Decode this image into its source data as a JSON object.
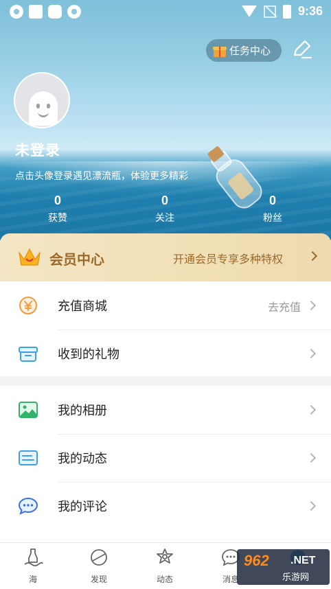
{
  "status_bar": {
    "time": "9:36"
  },
  "header": {
    "task_center_label": "任务中心",
    "username": "未登录",
    "login_hint": "点击头像登录遇见漂流瓶，体验更多精彩"
  },
  "stats": [
    {
      "value": "0",
      "label": "获赞"
    },
    {
      "value": "0",
      "label": "关注"
    },
    {
      "value": "0",
      "label": "粉丝"
    }
  ],
  "vip": {
    "title": "会员中心",
    "description": "开通会员专享多种特权"
  },
  "menu_group_1": [
    {
      "label": "充值商城",
      "right_text": "去充值",
      "icon": "coin-yen-icon"
    },
    {
      "label": "收到的礼物",
      "right_text": "",
      "icon": "gift-box-icon"
    }
  ],
  "menu_group_2": [
    {
      "label": "我的相册",
      "icon": "photo-album-icon"
    },
    {
      "label": "我的动态",
      "icon": "feed-card-icon"
    },
    {
      "label": "我的评论",
      "icon": "comment-bubble-icon"
    }
  ],
  "tabbar": [
    {
      "label": "海",
      "icon": "sea-bottle-icon"
    },
    {
      "label": "发现",
      "icon": "planet-icon"
    },
    {
      "label": "动态",
      "icon": "flower-icon"
    },
    {
      "label": "消息",
      "icon": "message-icon"
    },
    {
      "label": "",
      "icon": "profile-icon"
    }
  ],
  "watermark": {
    "main": "962",
    "domain": ".NET",
    "sub": "乐游网"
  },
  "colors": {
    "accent_gold": "#9b6a2b",
    "sea_blue": "#1f7fae",
    "menu_orange": "#f29a3a",
    "menu_blue": "#3aa0e8",
    "menu_green": "#33b36a"
  }
}
